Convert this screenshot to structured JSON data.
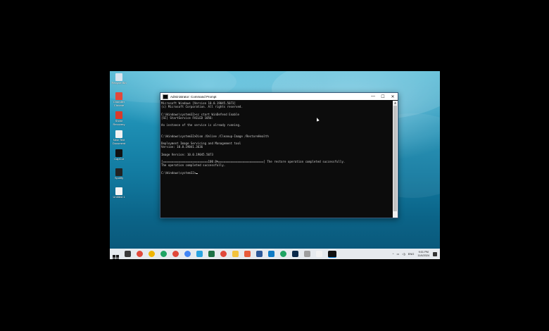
{
  "desktop": {
    "icons": [
      {
        "label": "Recycle Bin",
        "icon": "recycle-bin-icon",
        "color": "#d9e4ee"
      },
      {
        "label": "Chandler Chrome",
        "icon": "chrome-icon",
        "color": "#e2483b"
      },
      {
        "label": "Shree Recovery",
        "icon": "pdf-file-icon",
        "color": "#d93a2b"
      },
      {
        "label": "New Text Document",
        "icon": "text-file-icon",
        "color": "#f2f2f2"
      },
      {
        "label": "CapCut",
        "icon": "capcut-icon",
        "color": "#111111"
      },
      {
        "label": "Spotify",
        "icon": "app-shortcut-icon",
        "color": "#222222"
      },
      {
        "label": "Untitled 1",
        "icon": "document-icon",
        "color": "#f5f5f5"
      }
    ]
  },
  "cmd_window": {
    "title": "Administrator: Command Prompt",
    "controls": {
      "minimize": "—",
      "maximize": "☐",
      "close": "✕"
    },
    "lines": [
      "Microsoft Windows [Version 10.0.19045.5073]",
      "(c) Microsoft Corporation. All rights reserved.",
      "",
      "C:\\Windows\\system32>sc start WinDefend Enable",
      "[SC] StartService FAILED 1056:",
      "",
      "An instance of the service is already running.",
      "",
      "",
      "C:\\Windows\\system32>Dism /Online /Cleanup-Image /RestoreHealth",
      "",
      "Deployment Image Servicing and Management tool",
      "Version: 10.0.19041.3636",
      "",
      "Image Version: 10.0.19045.5073",
      "",
      "[==========================100.0%==========================] The restore operation completed successfully.",
      "The operation completed successfully.",
      "",
      "C:\\Windows\\system32>"
    ]
  },
  "taskbar": {
    "icons": [
      {
        "name": "windows-start-icon",
        "color": "#1a1a1a"
      },
      {
        "name": "task-view-icon",
        "color": "#3a3a3a"
      },
      {
        "name": "chrome-icon",
        "color": "#e0483a"
      },
      {
        "name": "chrome-icon",
        "color": "#f0b400"
      },
      {
        "name": "chrome-icon",
        "color": "#1fa463"
      },
      {
        "name": "chrome-icon",
        "color": "#e0483a"
      },
      {
        "name": "chrome-icon",
        "color": "#4285f4"
      },
      {
        "name": "telegram-icon",
        "color": "#2aa3df"
      },
      {
        "name": "excel-icon",
        "color": "#1e7145"
      },
      {
        "name": "chrome-icon",
        "color": "#e0483a"
      },
      {
        "name": "file-explorer-icon",
        "color": "#f3c23c"
      },
      {
        "name": "paint-icon",
        "color": "#e85b3b"
      },
      {
        "name": "word-icon",
        "color": "#2b5797"
      },
      {
        "name": "edge-icon",
        "color": "#0f7bc4"
      },
      {
        "name": "chrome-icon",
        "color": "#1fa463"
      },
      {
        "name": "photoshop-icon",
        "color": "#0b2a4a"
      },
      {
        "name": "app-icon",
        "color": "#9e9e9e"
      },
      {
        "name": "notepad-icon",
        "color": "#f2f2f2"
      },
      {
        "name": "cmd-icon",
        "color": "#111111"
      }
    ],
    "tray": {
      "language": "ENG",
      "time": "9:01 PM",
      "date": "11/4/2024"
    }
  }
}
